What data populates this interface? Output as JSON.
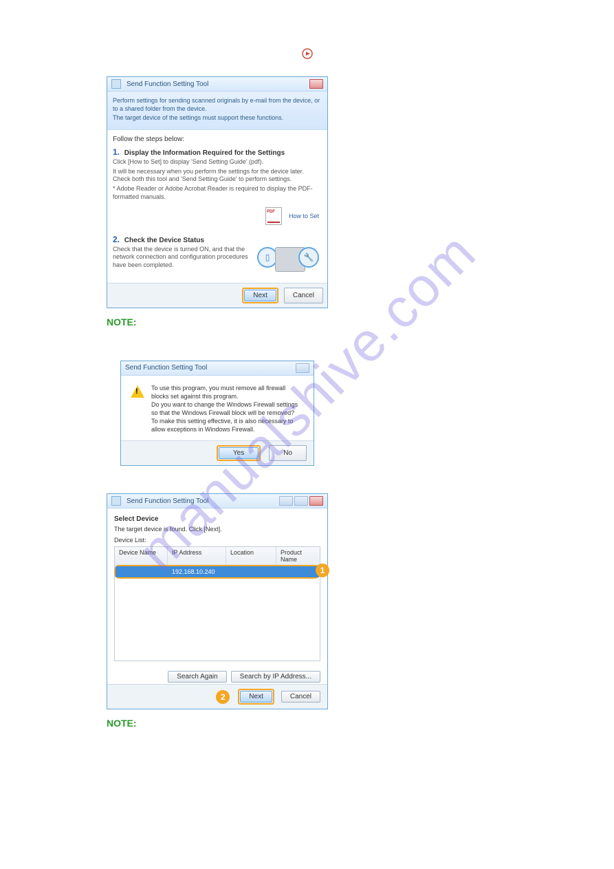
{
  "watermark": "manualshive.com",
  "dlg1": {
    "title": "Send Function Setting Tool",
    "intro1": "Perform settings for sending scanned originals by e-mail from the device, or to a shared folder from the device.",
    "intro2": "The target device of the settings must support these functions.",
    "follow": "Follow the steps below:",
    "step1_num": "1.",
    "step1_title": "Display the Information Required for the Settings",
    "step1_line1": "Click [How to Set] to display 'Send Setting Guide' (pdf).",
    "step1_line2": "It will be necessary when you perform the settings for the device later. Check both this tool and 'Send Setting Guide' to perform settings.",
    "step1_line3": "* Adobe Reader or Adobe Acrobat Reader is required to display the PDF-formatted manuals.",
    "how_to_set": "How to Set",
    "step2_num": "2.",
    "step2_title": "Check the Device Status",
    "step2_body": "Check that the device is turned ON, and that the network connection and configuration procedures have been completed.",
    "next": "Next",
    "cancel": "Cancel"
  },
  "note1": "NOTE:",
  "dlg2": {
    "title": "Send Function Setting Tool",
    "line1": "To use this program, you must remove all firewall blocks set against this program.",
    "line2": "Do you want to change the Windows Firewall settings so that the Windows Firewall block will be removed?",
    "line3": "To make this setting effective, it is also necessary to allow exceptions in Windows Firewall.",
    "yes": "Yes",
    "no": "No"
  },
  "dlg3": {
    "title": "Send Function Setting Tool",
    "heading": "Select Device",
    "subtext": "The target device is found. Click [Next].",
    "list_label": "Device List:",
    "cols": {
      "dn": "Device Name",
      "ip": "IP Address",
      "loc": "Location",
      "pn": "Product Name"
    },
    "row": {
      "dn": "",
      "ip": "192.168.10.240",
      "loc": "",
      "pn": ""
    },
    "search_again": "Search Again",
    "search_ip": "Search by IP Address...",
    "next": "Next",
    "cancel": "Cancel",
    "badge1": "1",
    "badge2": "2"
  },
  "note2": "NOTE:"
}
